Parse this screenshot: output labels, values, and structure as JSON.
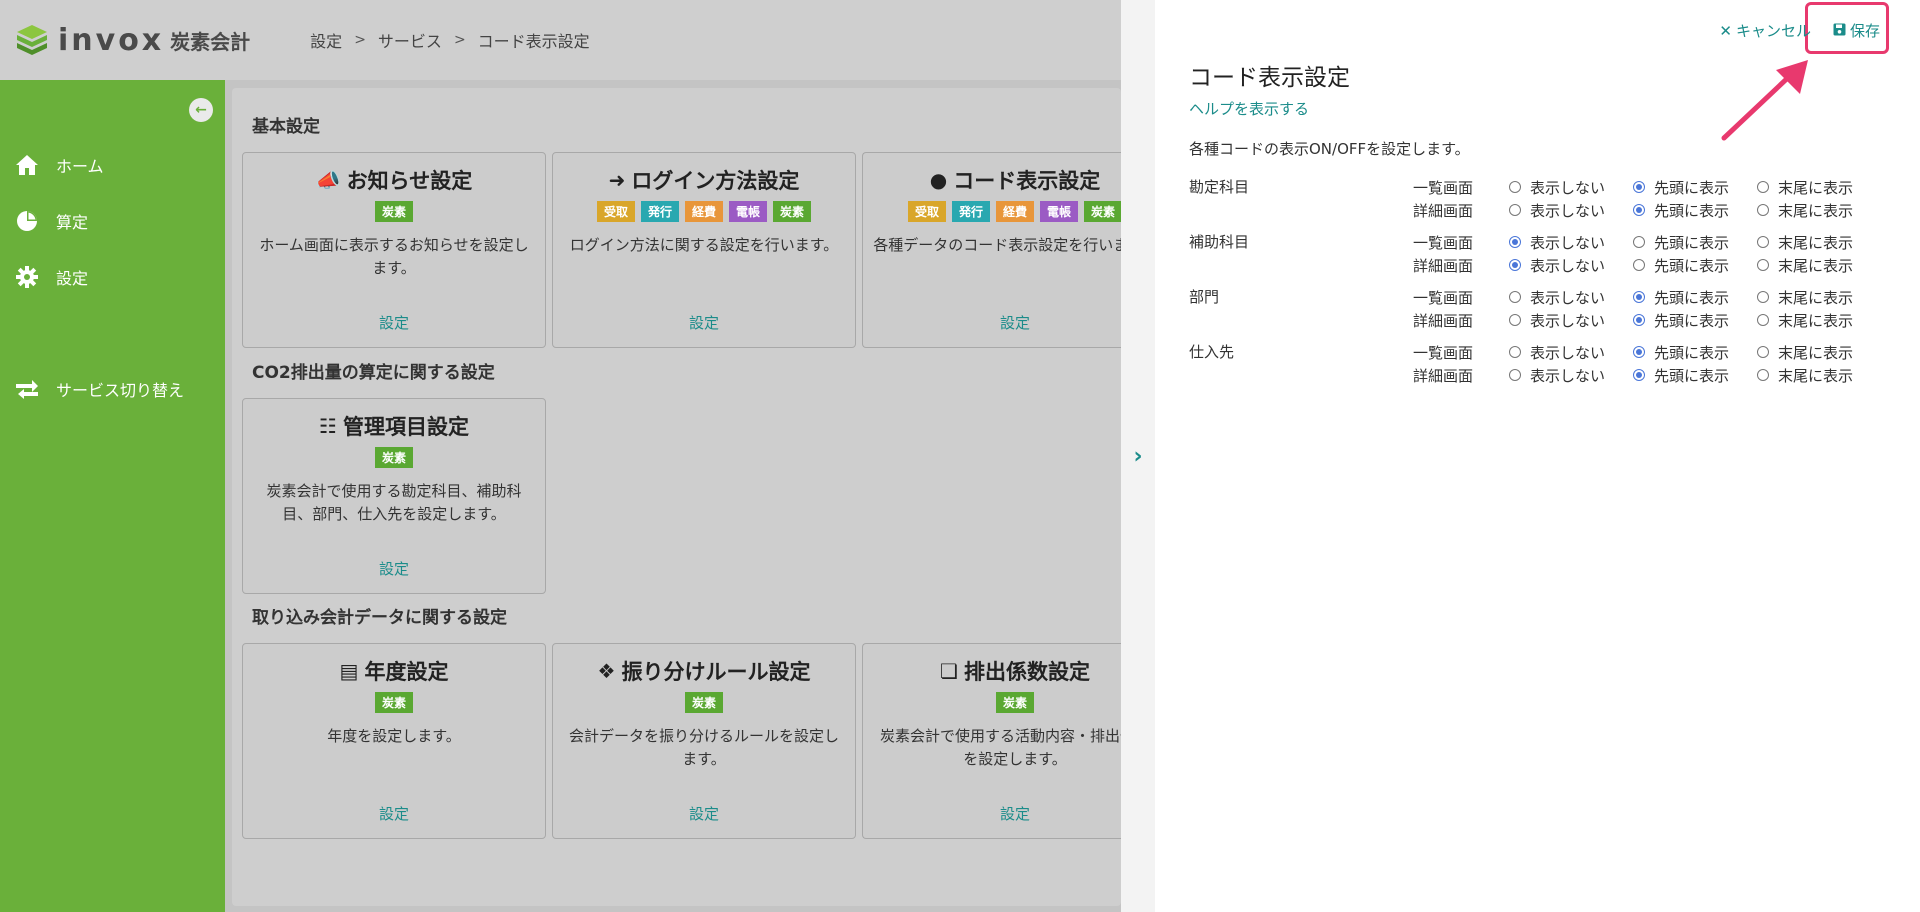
{
  "header": {
    "logo_text": "invox",
    "logo_sub": "炭素会計",
    "breadcrumb": [
      "設定",
      "サービス",
      "コード表示設定"
    ]
  },
  "sidebar": {
    "items": [
      {
        "label": "ホーム",
        "icon": "home-icon"
      },
      {
        "label": "算定",
        "icon": "pie-chart-icon"
      },
      {
        "label": "設定",
        "icon": "gear-icon"
      },
      {
        "label": "サービス切り替え",
        "icon": "switch-icon"
      }
    ]
  },
  "main": {
    "sections": [
      {
        "title": "基本設定",
        "cards": [
          {
            "title": "お知らせ設定",
            "icon": "megaphone-icon",
            "tags": [
              "炭素"
            ],
            "desc": "ホーム画面に表示するお知らせを設定します。",
            "link": "設定"
          },
          {
            "title": "ログイン方法設定",
            "icon": "login-icon",
            "tags": [
              "受取",
              "発行",
              "経費",
              "電帳",
              "炭素"
            ],
            "desc": "ログイン方法に関する設定を行います。",
            "link": "設定"
          },
          {
            "title": "コード表示設定",
            "icon": "abc-icon",
            "tags": [
              "受取",
              "発行",
              "経費",
              "電帳",
              "炭素"
            ],
            "desc": "各種データのコード表示設定を行います。",
            "link": "設定"
          }
        ]
      },
      {
        "title": "CO2排出量の算定に関する設定",
        "cards": [
          {
            "title": "管理項目設定",
            "icon": "sitemap-icon",
            "tags": [
              "炭素"
            ],
            "desc": "炭素会計で使用する勘定科目、補助科目、部門、仕入先を設定します。",
            "link": "設定"
          }
        ]
      },
      {
        "title": "取り込み会計データに関する設定",
        "cards": [
          {
            "title": "年度設定",
            "icon": "book-icon",
            "tags": [
              "炭素"
            ],
            "desc": "年度を設定します。",
            "link": "設定"
          },
          {
            "title": "振り分けルール設定",
            "icon": "rules-icon",
            "tags": [
              "炭素"
            ],
            "desc": "会計データを振り分けるルールを設定します。",
            "link": "設定"
          },
          {
            "title": "排出係数設定",
            "icon": "grid-icon",
            "tags": [
              "炭素"
            ],
            "desc": "炭素会計で使用する活動内容・排出係数を設定します。",
            "link": "設定"
          }
        ]
      }
    ]
  },
  "tag_colors": {
    "受取": "#d9a62a",
    "発行": "#29a8b0",
    "経費": "#e8963a",
    "電帳": "#9b5bc4",
    "炭素": "#5aa832"
  },
  "panel": {
    "cancel_label": "キャンセル",
    "save_label": "保存",
    "title": "コード表示設定",
    "help_link": "ヘルプを表示する",
    "description": "各種コードの表示ON/OFFを設定します。",
    "options": [
      "表示しない",
      "先頭に表示",
      "末尾に表示"
    ],
    "groups": [
      {
        "label": "勘定科目",
        "rows": [
          {
            "label": "一覧画面",
            "selected": 1
          },
          {
            "label": "詳細画面",
            "selected": 1
          }
        ]
      },
      {
        "label": "補助科目",
        "rows": [
          {
            "label": "一覧画面",
            "selected": 0
          },
          {
            "label": "詳細画面",
            "selected": 0
          }
        ]
      },
      {
        "label": "部門",
        "rows": [
          {
            "label": "一覧画面",
            "selected": 1
          },
          {
            "label": "詳細画面",
            "selected": 1
          }
        ]
      },
      {
        "label": "仕入先",
        "rows": [
          {
            "label": "一覧画面",
            "selected": 1
          },
          {
            "label": "詳細画面",
            "selected": 1
          }
        ]
      }
    ]
  },
  "colors": {
    "accent": "#1b8c8a",
    "sidebar": "#6ab03a",
    "highlight": "#e8396e",
    "radio": "#4a76d8"
  }
}
